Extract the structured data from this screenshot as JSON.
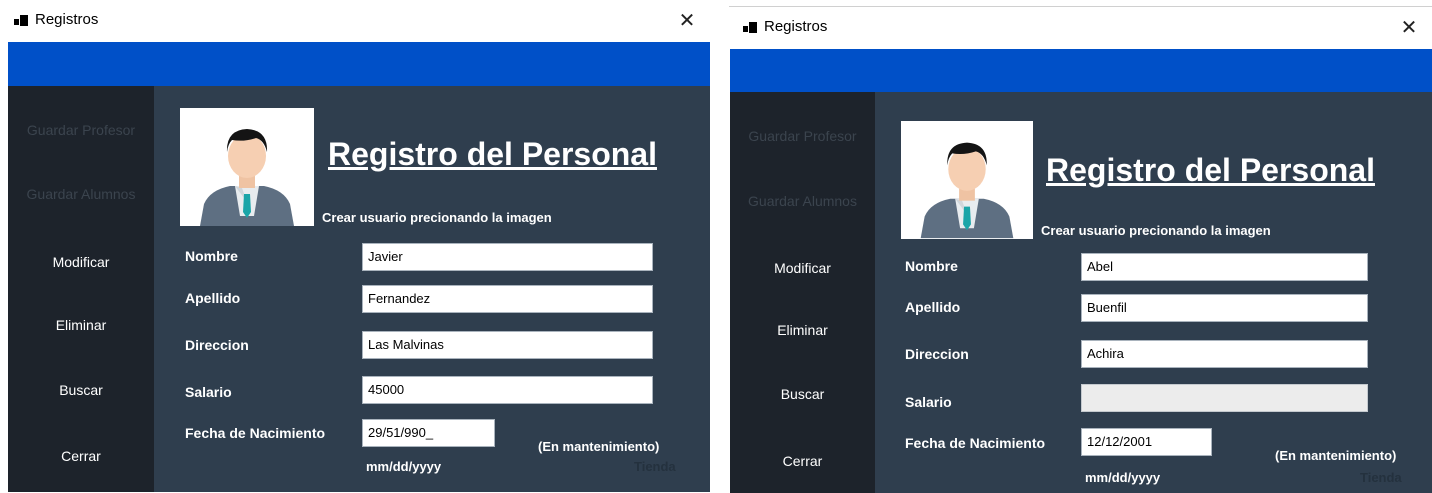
{
  "windows": [
    {
      "title": "Registros",
      "close_glyph": "✕",
      "sidebar": [
        "Guardar Profesor",
        "Guardar Alumnos",
        "Modificar",
        "Eliminar",
        "Buscar",
        "Cerrar"
      ],
      "heading": "Registro del Personal",
      "subheading": "Crear usuario precionando la imagen",
      "labels": {
        "nombre": "Nombre",
        "apellido": "Apellido",
        "direccion": "Direccion",
        "salario": "Salario",
        "fecha": "Fecha de Nacimiento"
      },
      "values": {
        "nombre": "Javier",
        "apellido": "Fernandez",
        "direccion": "Las Malvinas",
        "salario": "45000",
        "fecha": "29/51/990_"
      },
      "date_hint": "mm/dd/yyyy",
      "maintenance": "(En mantenimiento)",
      "store": "Tienda"
    },
    {
      "title": "Registros",
      "close_glyph": "✕",
      "sidebar": [
        "Guardar Profesor",
        "Guardar Alumnos",
        "Modificar",
        "Eliminar",
        "Buscar",
        "Cerrar"
      ],
      "heading": "Registro del Personal",
      "subheading": "Crear usuario precionando la imagen",
      "labels": {
        "nombre": "Nombre",
        "apellido": "Apellido",
        "direccion": "Direccion",
        "salario": "Salario",
        "fecha": "Fecha de Nacimiento"
      },
      "values": {
        "nombre": "Abel",
        "apellido": "Buenfil",
        "direccion": "Achira",
        "salario": "",
        "fecha": "12/12/2001"
      },
      "date_hint": "mm/dd/yyyy",
      "maintenance": "(En mantenimiento)",
      "store": "Tienda"
    }
  ],
  "icons": {
    "app": "app-icon",
    "close": "close-icon",
    "avatar": "user-avatar-icon"
  },
  "colors": {
    "accent_bar": "#0050c8",
    "sidebar_bg": "#1d232b",
    "main_bg": "#2f3e4e"
  }
}
